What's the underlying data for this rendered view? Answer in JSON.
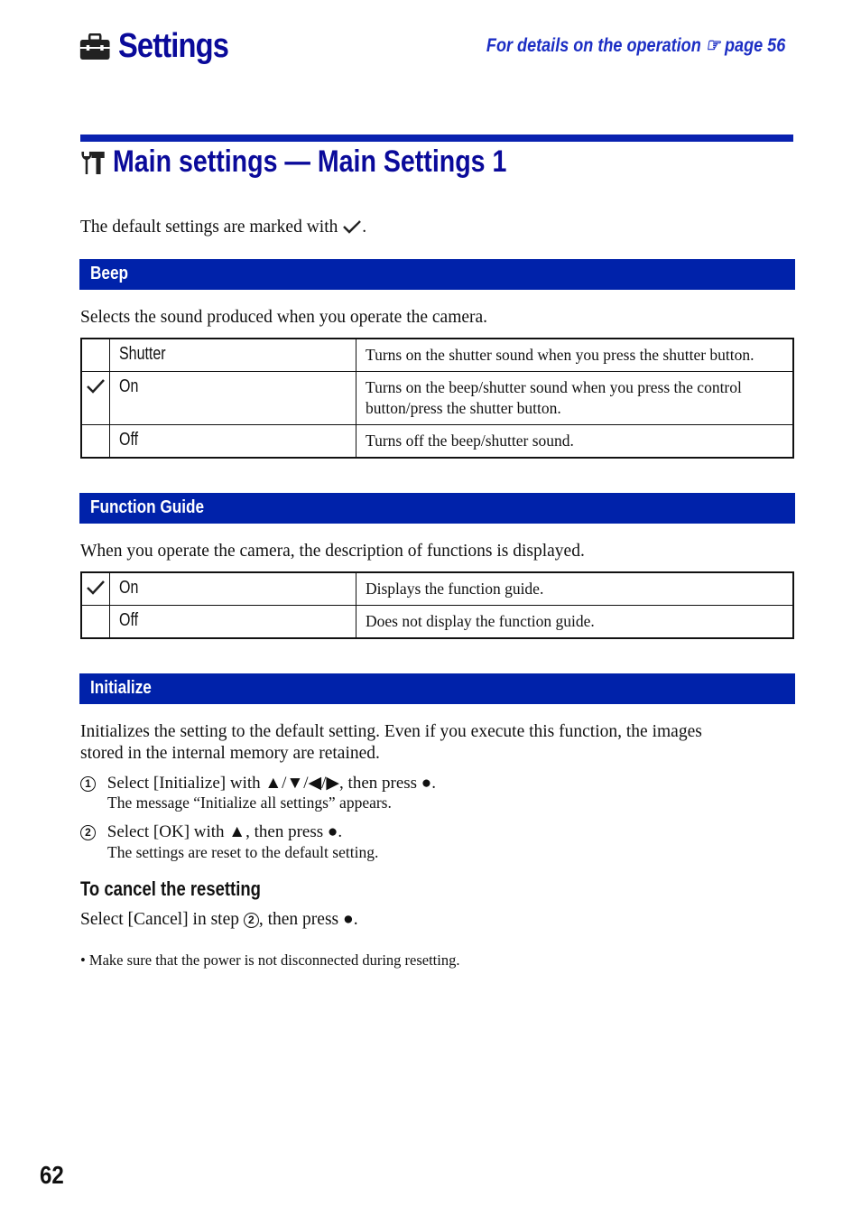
{
  "header": {
    "title": "Settings",
    "title_icon": "toolbox-icon",
    "reference": "For details on the operation",
    "reference_icon": "pointing-hand-icon",
    "reference_page": "page 56"
  },
  "section": {
    "title": "Main settings — Main Settings 1",
    "icon": "wrench-hammer-icon",
    "default_note_prefix": "The default settings are marked with",
    "default_note_suffix": "."
  },
  "beep": {
    "heading": "Beep",
    "description": "Selects the sound produced when you operate the camera.",
    "rows": [
      {
        "default": false,
        "option": "Shutter",
        "desc": "Turns on the shutter sound when you press the shutter button."
      },
      {
        "default": true,
        "option": "On",
        "desc": "Turns on the beep/shutter sound when you press the control button/press the shutter button."
      },
      {
        "default": false,
        "option": "Off",
        "desc": "Turns off the beep/shutter sound."
      }
    ]
  },
  "function_guide": {
    "heading": "Function Guide",
    "description": "When you operate the camera, the description of functions is displayed.",
    "rows": [
      {
        "default": true,
        "option": "On",
        "desc": "Displays the function guide."
      },
      {
        "default": false,
        "option": "Off",
        "desc": "Does not display the function guide."
      }
    ]
  },
  "initialize": {
    "heading": "Initialize",
    "description_line1": "Initializes the setting to the default setting. Even if you execute this function, the images",
    "description_line2": "stored in the internal memory are retained.",
    "steps": [
      {
        "num": "1",
        "text": "Select [Initialize] with ▲/▼/◀/▶, then press ●.",
        "result": "The message “Initialize all settings” appears."
      },
      {
        "num": "2",
        "text": "Select [OK] with ▲, then press ●.",
        "result": "The settings are reset to the default setting."
      }
    ],
    "cancel_heading": "To cancel the resetting",
    "cancel_prefix": "Select [Cancel] in step",
    "cancel_step": "2",
    "cancel_suffix": ", then press ●.",
    "note": "Make sure that the power is not disconnected during resetting."
  },
  "page_number": "62"
}
